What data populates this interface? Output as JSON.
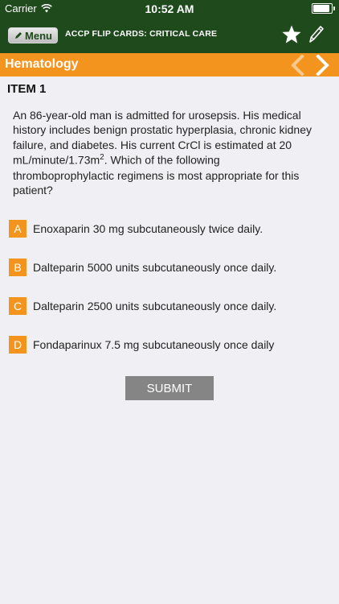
{
  "status_bar": {
    "carrier": "Carrier",
    "time": "10:52 AM"
  },
  "nav": {
    "menu_label": "Menu",
    "app_title": "ACCP FLIP CARDS: CRITICAL CARE",
    "star_icon": "star-icon",
    "edit_icon": "pencil-icon"
  },
  "section": {
    "title": "Hematology",
    "prev_icon": "chevron-left-icon",
    "next_icon": "chevron-right-icon"
  },
  "item": {
    "heading": "ITEM 1",
    "question_part1": "An 86-year-old man is admitted for urosepsis. His medical history includes benign prostatic hyperplasia, chronic kidney failure, and diabetes. His current CrCl is estimated at 20 mL/minute/1.73m",
    "question_sup": "2",
    "question_part2": ". Which of the following thromboprophylactic regimens is most appropriate for this patient?"
  },
  "answers": [
    {
      "letter": "A",
      "text": "Enoxaparin 30 mg subcutaneously twice daily."
    },
    {
      "letter": "B",
      "text": "Dalteparin 5000 units subcutaneously once daily."
    },
    {
      "letter": "C",
      "text": "Dalteparin 2500 units subcutaneously once daily."
    },
    {
      "letter": "D",
      "text": "Fondaparinux 7.5 mg subcutaneously once daily"
    }
  ],
  "submit_label": "SUBMIT",
  "colors": {
    "nav_green": "#1f4a1c",
    "accent_orange": "#f3941e",
    "background": "#efeff4",
    "submit_gray": "#858585"
  }
}
